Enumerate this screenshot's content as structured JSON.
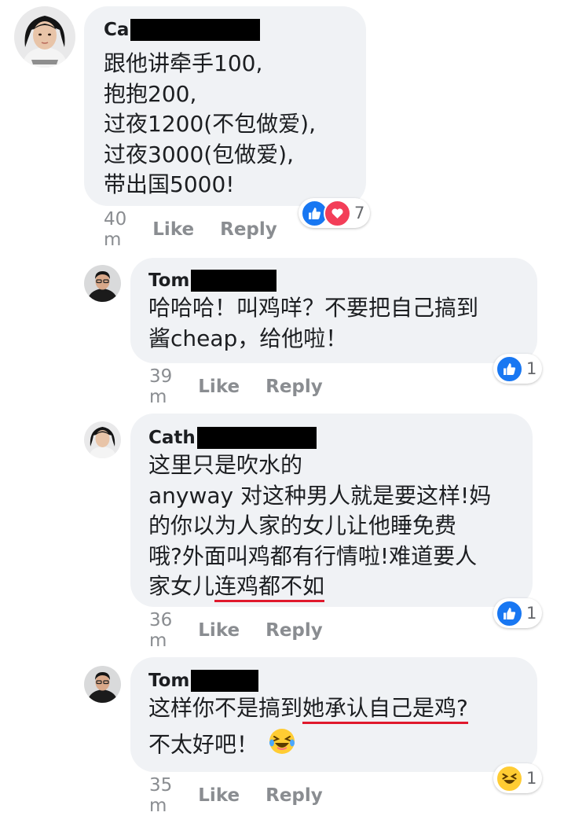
{
  "comments": [
    {
      "author": "Ca",
      "lines": [
        "跟他讲牵手100,",
        "抱抱200,",
        "过夜1200(不包做爱),",
        "过夜3000(包做爱),",
        "带出国5000!"
      ],
      "time": "40 m",
      "like_label": "Like",
      "reply_label": "Reply",
      "reaction_icons": [
        "like-icon",
        "love-icon"
      ],
      "reaction_count": "7"
    },
    {
      "author": "Tom",
      "lines": [
        "哈哈哈！叫鸡咩？不要把自己搞到",
        "酱cheap，给他啦！"
      ],
      "time": "39 m",
      "like_label": "Like",
      "reply_label": "Reply",
      "reaction_icons": [
        "like-icon"
      ],
      "reaction_count": "1"
    },
    {
      "author": "Cath",
      "lines": [
        "这里只是吹水的",
        "anyway 对这种男人就是要这样!妈",
        "的你以为人家的女儿让他睡免费",
        "哦?外面叫鸡都有行情啦!难道要人"
      ],
      "last_line_plain": "家女儿",
      "last_line_underlined": "连鸡都不如",
      "time": "36 m",
      "like_label": "Like",
      "reply_label": "Reply",
      "reaction_icons": [
        "like-icon"
      ],
      "reaction_count": "1"
    },
    {
      "author": "Tom",
      "line1_plain": "这样你不是搞到",
      "line1_underlined": "她承认自己是鸡?",
      "line2": "不太好吧！",
      "line2_emoji": "laughing-tears-emoji",
      "time": "35 m",
      "like_label": "Like",
      "reply_label": "Reply",
      "reaction_icons": [
        "haha-icon"
      ],
      "reaction_count": "1"
    }
  ],
  "colors": {
    "bubble": "#f0f2f5",
    "like_blue": "#1877f2",
    "love_red": "#f33e58",
    "underline_red": "#e0192c",
    "meta_gray": "#8a8d91"
  }
}
